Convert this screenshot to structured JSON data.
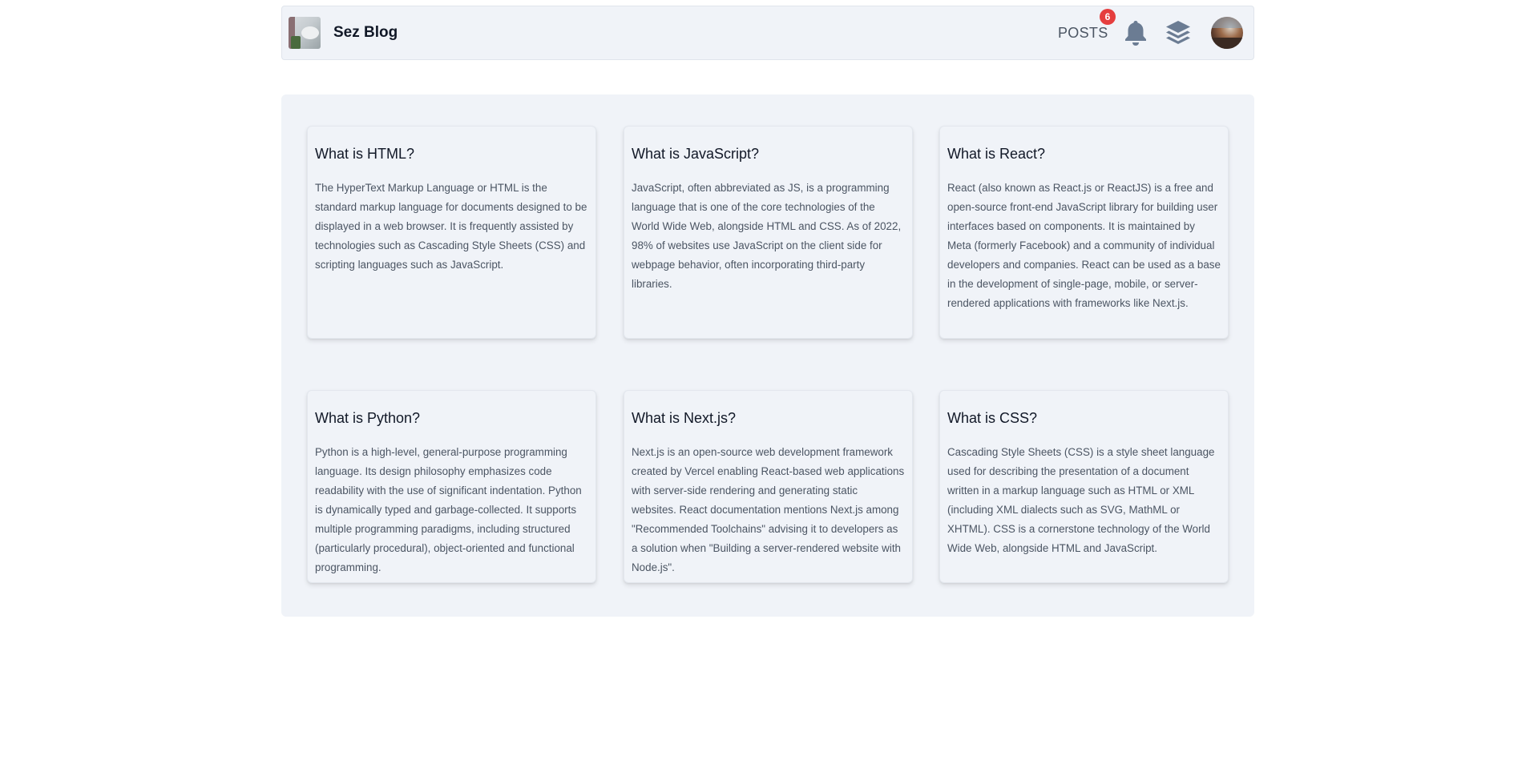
{
  "header": {
    "brand_title": "Sez Blog",
    "posts_label": "POSTS",
    "notification_count": "6",
    "icons": [
      "bell-icon",
      "layers-icon",
      "avatar"
    ]
  },
  "colors": {
    "badge": "#e53e3e",
    "surface": "#f0f3f8",
    "icon": "#6b7c93"
  },
  "posts": [
    {
      "title": "What is HTML?",
      "body": "The HyperText Markup Language or HTML is the standard markup language for documents designed to be displayed in a web browser. It is frequently assisted by technologies such as Cascading Style Sheets (CSS) and scripting languages such as JavaScript."
    },
    {
      "title": "What is JavaScript?",
      "body": "JavaScript, often abbreviated as JS, is a programming language that is one of the core technologies of the World Wide Web, alongside HTML and CSS. As of 2022, 98% of websites use JavaScript on the client side for webpage behavior, often incorporating third-party libraries."
    },
    {
      "title": "What is React?",
      "body": "React (also known as React.js or ReactJS) is a free and open-source front-end JavaScript library for building user interfaces based on components. It is maintained by Meta (formerly Facebook) and a community of individual developers and companies. React can be used as a base in the development of single-page, mobile, or server-rendered applications with frameworks like Next.js."
    },
    {
      "title": "What is Python?",
      "body": "Python is a high-level, general-purpose programming language. Its design philosophy emphasizes code readability with the use of significant indentation. Python is dynamically typed and garbage-collected. It supports multiple programming paradigms, including structured (particularly procedural), object-oriented and functional programming."
    },
    {
      "title": "What is Next.js?",
      "body": "Next.js is an open-source web development framework created by Vercel enabling React-based web applications with server-side rendering and generating static websites. React documentation mentions Next.js among \"Recommended Toolchains\" advising it to developers as a solution when \"Building a server-rendered website with Node.js\"."
    },
    {
      "title": "What is CSS?",
      "body": "Cascading Style Sheets (CSS) is a style sheet language used for describing the presentation of a document written in a markup language such as HTML or XML (including XML dialects such as SVG, MathML or XHTML). CSS is a cornerstone technology of the World Wide Web, alongside HTML and JavaScript."
    }
  ]
}
